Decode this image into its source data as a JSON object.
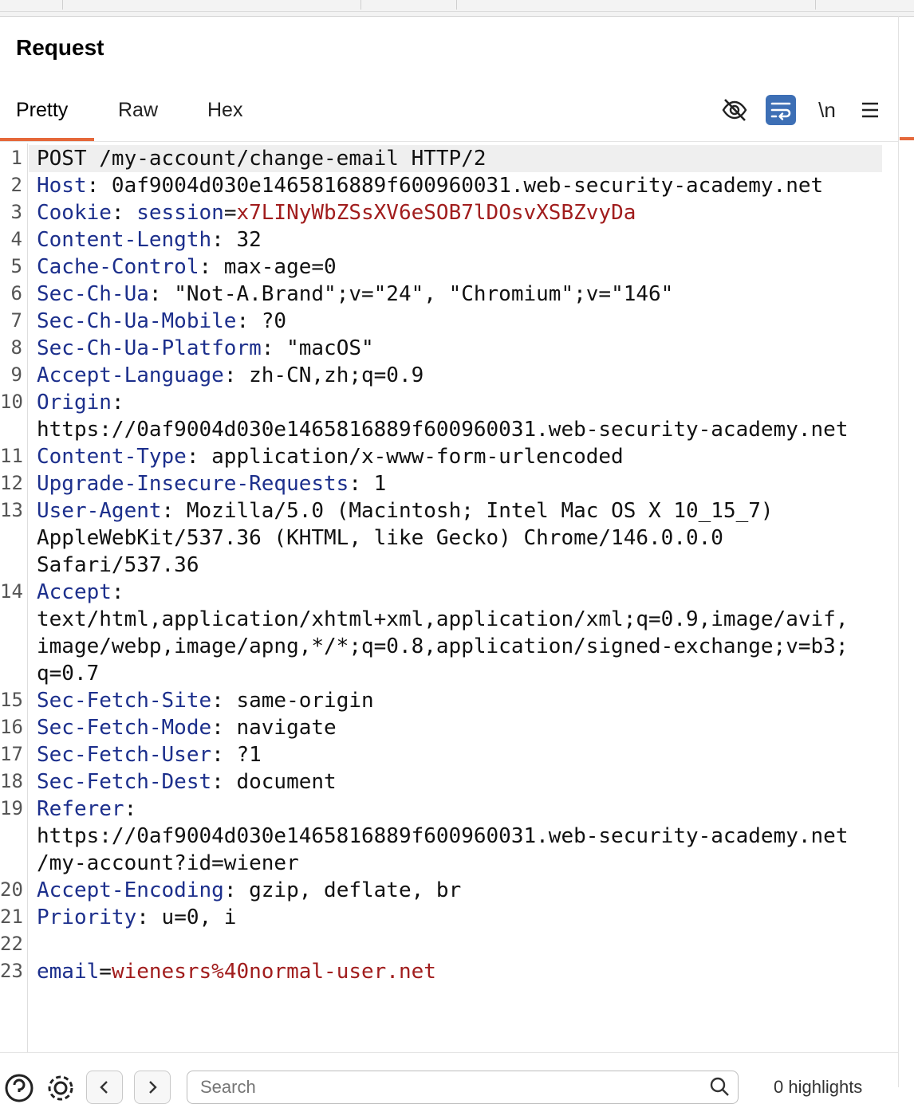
{
  "panel": {
    "title": "Request"
  },
  "tabs": [
    {
      "label": "Pretty",
      "active": true
    },
    {
      "label": "Raw",
      "active": false
    },
    {
      "label": "Hex",
      "active": false
    }
  ],
  "toolbar": {
    "newline_label": "\\n",
    "icons": [
      "eye-off-icon",
      "wrap-lines-icon",
      "newline-icon",
      "menu-icon"
    ]
  },
  "colors": {
    "accent": "#e5683a",
    "header_name": "#1c2f8c",
    "param_value": "#a11d1d",
    "wrap_button_bg": "#3d6fb5"
  },
  "editor": {
    "line_numbers": [
      "1",
      "2",
      "3",
      "4",
      "5",
      "6",
      "7",
      "8",
      "9",
      "10",
      "11",
      "12",
      "13",
      "14",
      "15",
      "16",
      "17",
      "18",
      "19",
      "20",
      "21",
      "22",
      "23"
    ],
    "lines": {
      "l1": "POST /my-account/change-email HTTP/2",
      "l2_name": "Host",
      "l2_value": " 0af9004d030e1465816889f600960031.web-security-academy.net",
      "l3_name": "Cookie",
      "l3_param": "session",
      "l3_value": "x7LINyWbZSsXV6eSOB7lDOsvXSBZvyDa",
      "l4_name": "Content-Length",
      "l4_value": " 32",
      "l5_name": "Cache-Control",
      "l5_value": " max-age=0",
      "l6_name": "Sec-Ch-Ua",
      "l6_value": " \"Not-A.Brand\";v=\"24\", \"Chromium\";v=\"146\"",
      "l7_name": "Sec-Ch-Ua-Mobile",
      "l7_value": " ?0",
      "l8_name": "Sec-Ch-Ua-Platform",
      "l8_value": " \"macOS\"",
      "l9_name": "Accept-Language",
      "l9_value": " zh-CN,zh;q=0.9",
      "l10_name": "Origin",
      "l10_value": "https://0af9004d030e1465816889f600960031.web-security-academy.net",
      "l11_name": "Content-Type",
      "l11_value": " application/x-www-form-urlencoded",
      "l12_name": "Upgrade-Insecure-Requests",
      "l12_value": " 1",
      "l13_name": "User-Agent",
      "l13_value_a": " Mozilla/5.0 (Macintosh; Intel Mac OS X 10_15_7)",
      "l13_value_b": "AppleWebKit/537.36 (KHTML, like Gecko) Chrome/146.0.0.0",
      "l13_value_c": "Safari/537.36",
      "l14_name": "Accept",
      "l14_value_a": "text/html,application/xhtml+xml,application/xml;q=0.9,image/avif,",
      "l14_value_b": "image/webp,image/apng,*/*;q=0.8,application/signed-exchange;v=b3;",
      "l14_value_c": "q=0.7",
      "l15_name": "Sec-Fetch-Site",
      "l15_value": " same-origin",
      "l16_name": "Sec-Fetch-Mode",
      "l16_value": " navigate",
      "l17_name": "Sec-Fetch-User",
      "l17_value": " ?1",
      "l18_name": "Sec-Fetch-Dest",
      "l18_value": " document",
      "l19_name": "Referer",
      "l19_value_a": "https://0af9004d030e1465816889f600960031.web-security-academy.net",
      "l19_value_b": "/my-account?id=wiener",
      "l20_name": "Accept-Encoding",
      "l20_value": " gzip, deflate, br",
      "l21_name": "Priority",
      "l21_value": " u=0, i",
      "l23_param": "email",
      "l23_value": "wienesrs%40normal-user.net"
    }
  },
  "bottom": {
    "search_placeholder": "Search",
    "highlights_text": "0 highlights"
  }
}
